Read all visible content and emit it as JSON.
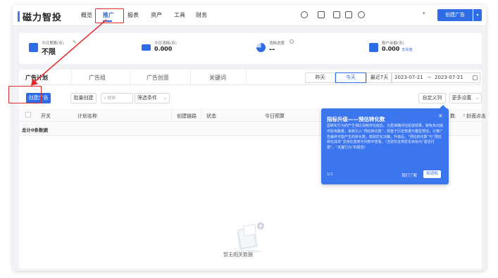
{
  "app": {
    "logo_text": "磁力智投"
  },
  "nav": {
    "items": [
      "概览",
      "推广",
      "报表",
      "资产",
      "工具",
      "财务"
    ],
    "active": "推广"
  },
  "topbar": {
    "create_button": "创建广告",
    "dropdown_arrow": "▾"
  },
  "stats": [
    {
      "label": "今日预算(币)",
      "value": "不限",
      "edit_icon": "edit-icon",
      "icon": "budget-icon",
      "color": "#2e6be6"
    },
    {
      "label": "今日消耗(币)",
      "value": "0.000",
      "icon": "wallet-icon",
      "color": "#2e6be6"
    },
    {
      "label": "消耗进度",
      "value": "--",
      "icon": "pie-icon",
      "color": "#2e6be6"
    },
    {
      "label": "账户余额(币)",
      "value": "0.000",
      "link": "去充值",
      "icon": "balance-icon",
      "color": "#2e6be6"
    }
  ],
  "tabs": [
    "广告计划",
    "广告组",
    "广告创意",
    "关键词"
  ],
  "date_range": {
    "buttons": [
      "昨天",
      "今天",
      "最近7天"
    ],
    "active": "今天",
    "start": "2023-07-21",
    "separator": "→",
    "end": "2023-07-21"
  },
  "toolbar": {
    "create": "创建广告",
    "batch": "批量创建",
    "search_placeholder": "搜索",
    "filter": "筛选条件",
    "custom_columns": "自定义列",
    "more_settings": "更多设置"
  },
  "table": {
    "headers": [
      "开关",
      "计划名称",
      "创建链路",
      "状态",
      "今日预算",
      "数",
      "封面点击数"
    ],
    "total_row": "总计0条数据"
  },
  "empty": {
    "text": "暂无相关数据"
  },
  "popup": {
    "title": "指标升级——预估转化数",
    "close": "×",
    "body": "因转化行为的产生相比消耗存在延后，为更准确评估投放效果，避免负向操作影响跑量，系统引入“预估转化数”，即基于历史数据与模型预估，计算广告最终可能产生的转化数，帮助优化决策。升级后，“预估转化数”与“预估转化成本”支持在报表与列表中查看。（当前仅支持优化目标为“激活付费”、“关键行为”的报告）",
    "page": "1/1",
    "more": "我们了解",
    "ok": "知道啦"
  },
  "colors": {
    "primary": "#2e6be6",
    "annotation": "#e52a2a",
    "popup": "#3c76ee"
  }
}
